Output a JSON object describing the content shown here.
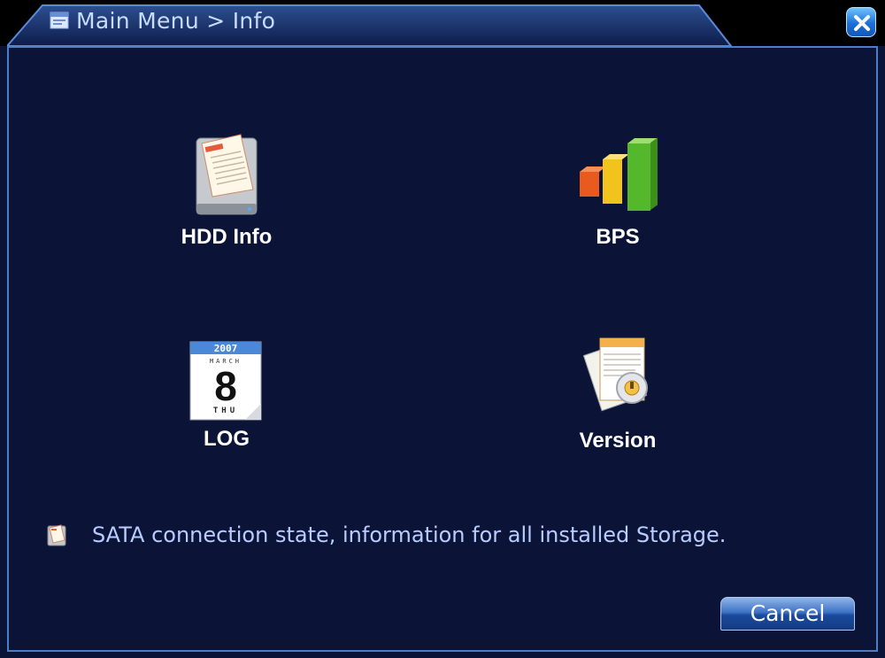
{
  "window": {
    "breadcrumb": "Main Menu > Info",
    "title_icon": "window-icon",
    "close_icon": "close-icon"
  },
  "tiles": [
    {
      "label": "HDD Info",
      "icon": "hdd-info-icon"
    },
    {
      "label": "BPS",
      "icon": "bps-bar-chart-icon"
    },
    {
      "label": "LOG",
      "icon": "log-calendar-icon"
    },
    {
      "label": "Version",
      "icon": "version-document-icon"
    }
  ],
  "hint": {
    "text": "SATA connection state, information for all installed Storage.",
    "icon": "hdd-mini-icon"
  },
  "buttons": {
    "cancel": "Cancel"
  },
  "log_icon_text": {
    "year": "2007",
    "day": "8",
    "weekday": "THU",
    "month": "MARCH"
  },
  "colors": {
    "background": "#0b1437",
    "frame": "#4a7fc8",
    "title_text": "#c9dcff",
    "hint_text": "#b8ccff"
  }
}
